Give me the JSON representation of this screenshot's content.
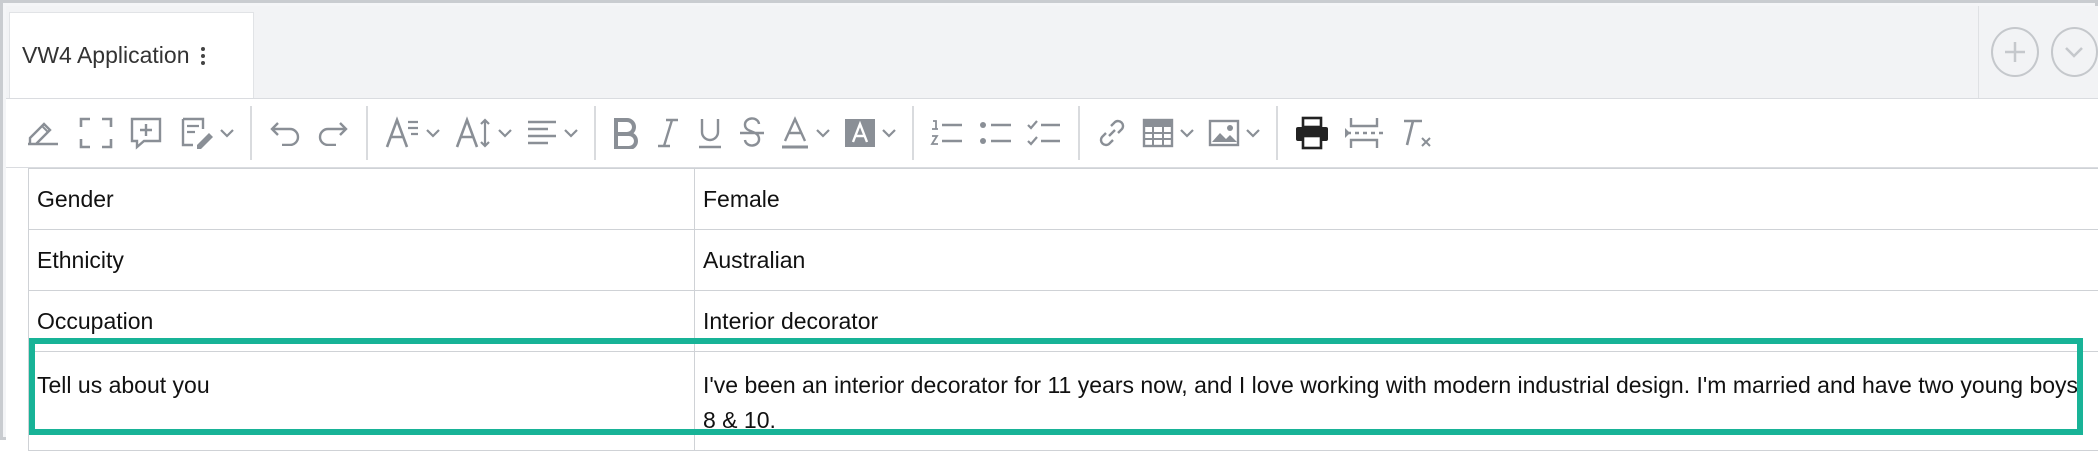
{
  "tab": {
    "title": "VW4 Application"
  },
  "tab_actions": {
    "add_icon": "plus-circle-icon",
    "collapse_icon": "chevron-down-circle-icon"
  },
  "toolbar": {
    "icons": [
      "edit-fields-icon",
      "fullscreen-icon",
      "insert-comment-icon",
      "track-changes-icon",
      "undo-icon",
      "redo-icon",
      "font-family-icon",
      "font-size-icon",
      "alignment-icon",
      "bold-icon",
      "italic-icon",
      "underline-icon",
      "strikethrough-icon",
      "font-color-icon",
      "highlight-color-icon",
      "numbered-list-icon",
      "bulleted-list-icon",
      "todo-list-icon",
      "link-icon",
      "table-icon",
      "image-icon",
      "print-icon",
      "page-break-icon",
      "remove-format-icon"
    ]
  },
  "table": {
    "rows": [
      {
        "label": "Gender",
        "value": "Female"
      },
      {
        "label": "Ethnicity",
        "value": "Australian"
      },
      {
        "label": "Occupation",
        "value": "Interior decorator"
      },
      {
        "label": "Tell us about you",
        "value": "I've been an interior decorator for 11 years now, and I love working with modern industrial design. I'm married and have two young boys, 8 & 10."
      }
    ]
  },
  "colors": {
    "highlight": "#18b397",
    "icon": "#8a8f96"
  }
}
